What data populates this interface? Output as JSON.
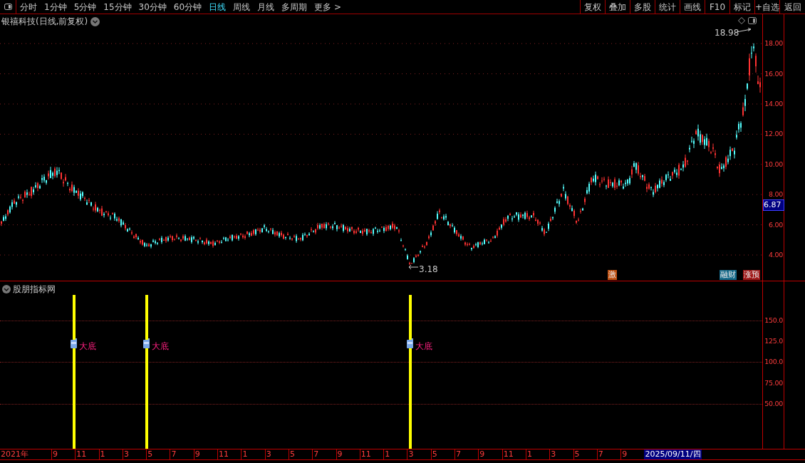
{
  "toolbar": {
    "tabs": [
      {
        "label": "分时",
        "selected": false
      },
      {
        "label": "1分钟",
        "selected": false
      },
      {
        "label": "5分钟",
        "selected": false
      },
      {
        "label": "15分钟",
        "selected": false
      },
      {
        "label": "30分钟",
        "selected": false
      },
      {
        "label": "60分钟",
        "selected": false
      },
      {
        "label": "日线",
        "selected": true
      },
      {
        "label": "周线",
        "selected": false
      },
      {
        "label": "月线",
        "selected": false
      },
      {
        "label": "多周期",
        "selected": false
      },
      {
        "label": "更多 >",
        "selected": false
      }
    ],
    "buttons": [
      "复权",
      "叠加",
      "多股",
      "统计",
      "画线",
      "F10",
      "标记",
      "+自选",
      "返回"
    ]
  },
  "main_chart": {
    "title": "银禧科技(日线,前复权)",
    "high_label": "18.98",
    "low_label": "3.18",
    "y_ticks": [
      "18.00",
      "16.00",
      "14.00",
      "12.00",
      "10.00",
      "8.00",
      "6.00",
      "4.00"
    ],
    "current_price": "6.87",
    "badges": [
      {
        "label": "激",
        "color": "#c05010"
      },
      {
        "label": "融财",
        "color": "#156a8a"
      },
      {
        "label": "涨预",
        "color": "#a01818"
      }
    ]
  },
  "indicator_panel": {
    "title": "股朋指标网",
    "signals": [
      {
        "label": "大底"
      },
      {
        "label": "大底"
      },
      {
        "label": "大底"
      }
    ],
    "y_ticks": [
      "150.0",
      "125.0",
      "100.0",
      "75.00",
      "50.00"
    ]
  },
  "date_axis": {
    "labels": [
      "2021年",
      "9",
      "11",
      "1",
      "3",
      "5",
      "7",
      "9",
      "11",
      "1",
      "3",
      "5",
      "7",
      "9",
      "11",
      "1",
      "3",
      "5",
      "7",
      "9",
      "11",
      "1",
      "3",
      "5",
      "7",
      "9"
    ],
    "current_date": "2025/09/11/四"
  }
}
